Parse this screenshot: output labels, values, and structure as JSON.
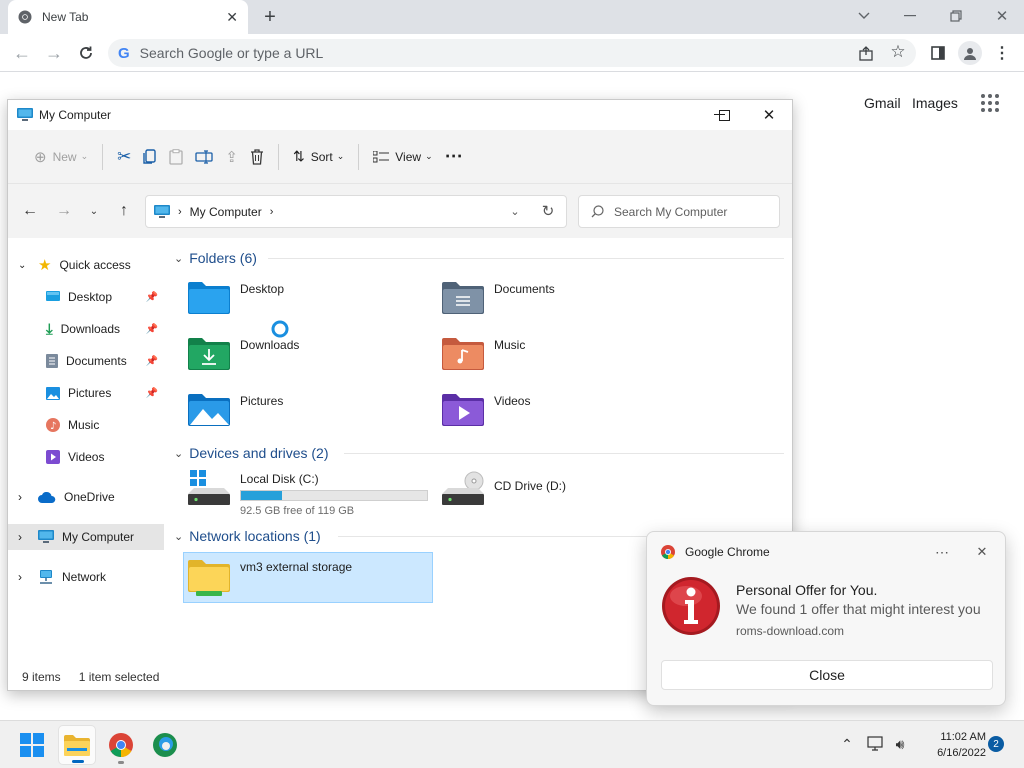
{
  "browser": {
    "tab_title": "New Tab",
    "omnibox_placeholder": "Search Google or type a URL",
    "links": {
      "gmail": "Gmail",
      "images": "Images"
    }
  },
  "explorer": {
    "window_title": "My Computer",
    "commands": {
      "new": "New",
      "sort": "Sort",
      "view": "View"
    },
    "address": "My Computer",
    "search_placeholder": "Search My Computer",
    "nav": {
      "quick_access": "Quick access",
      "quick_items": [
        "Desktop",
        "Downloads",
        "Documents",
        "Pictures",
        "Music",
        "Videos"
      ],
      "onedrive": "OneDrive",
      "my_computer": "My Computer",
      "network": "Network"
    },
    "sections": {
      "folders": "Folders (6)",
      "drives": "Devices and drives (2)",
      "network": "Network locations (1)"
    },
    "folders": [
      "Desktop",
      "Documents",
      "Downloads",
      "Music",
      "Pictures",
      "Videos"
    ],
    "drives": {
      "c_name": "Local Disk (C:)",
      "c_free": "92.5 GB free of 119 GB",
      "c_used_fraction": 0.22,
      "d_name": "CD Drive (D:)"
    },
    "network_item": "vm3 external storage",
    "status": {
      "count": "9 items",
      "selected": "1 item selected"
    }
  },
  "toast": {
    "app": "Google Chrome",
    "title": "Personal Offer for You.",
    "body": "We found 1 offer that might interest you",
    "source": "roms-download.com",
    "button": "Close"
  },
  "taskbar": {
    "time": "11:02 AM",
    "date": "6/16/2022",
    "badge": "2"
  },
  "colors": {
    "accent": "#0067c0",
    "toast_icon": "#c0262c",
    "selection": "#cce8ff"
  }
}
